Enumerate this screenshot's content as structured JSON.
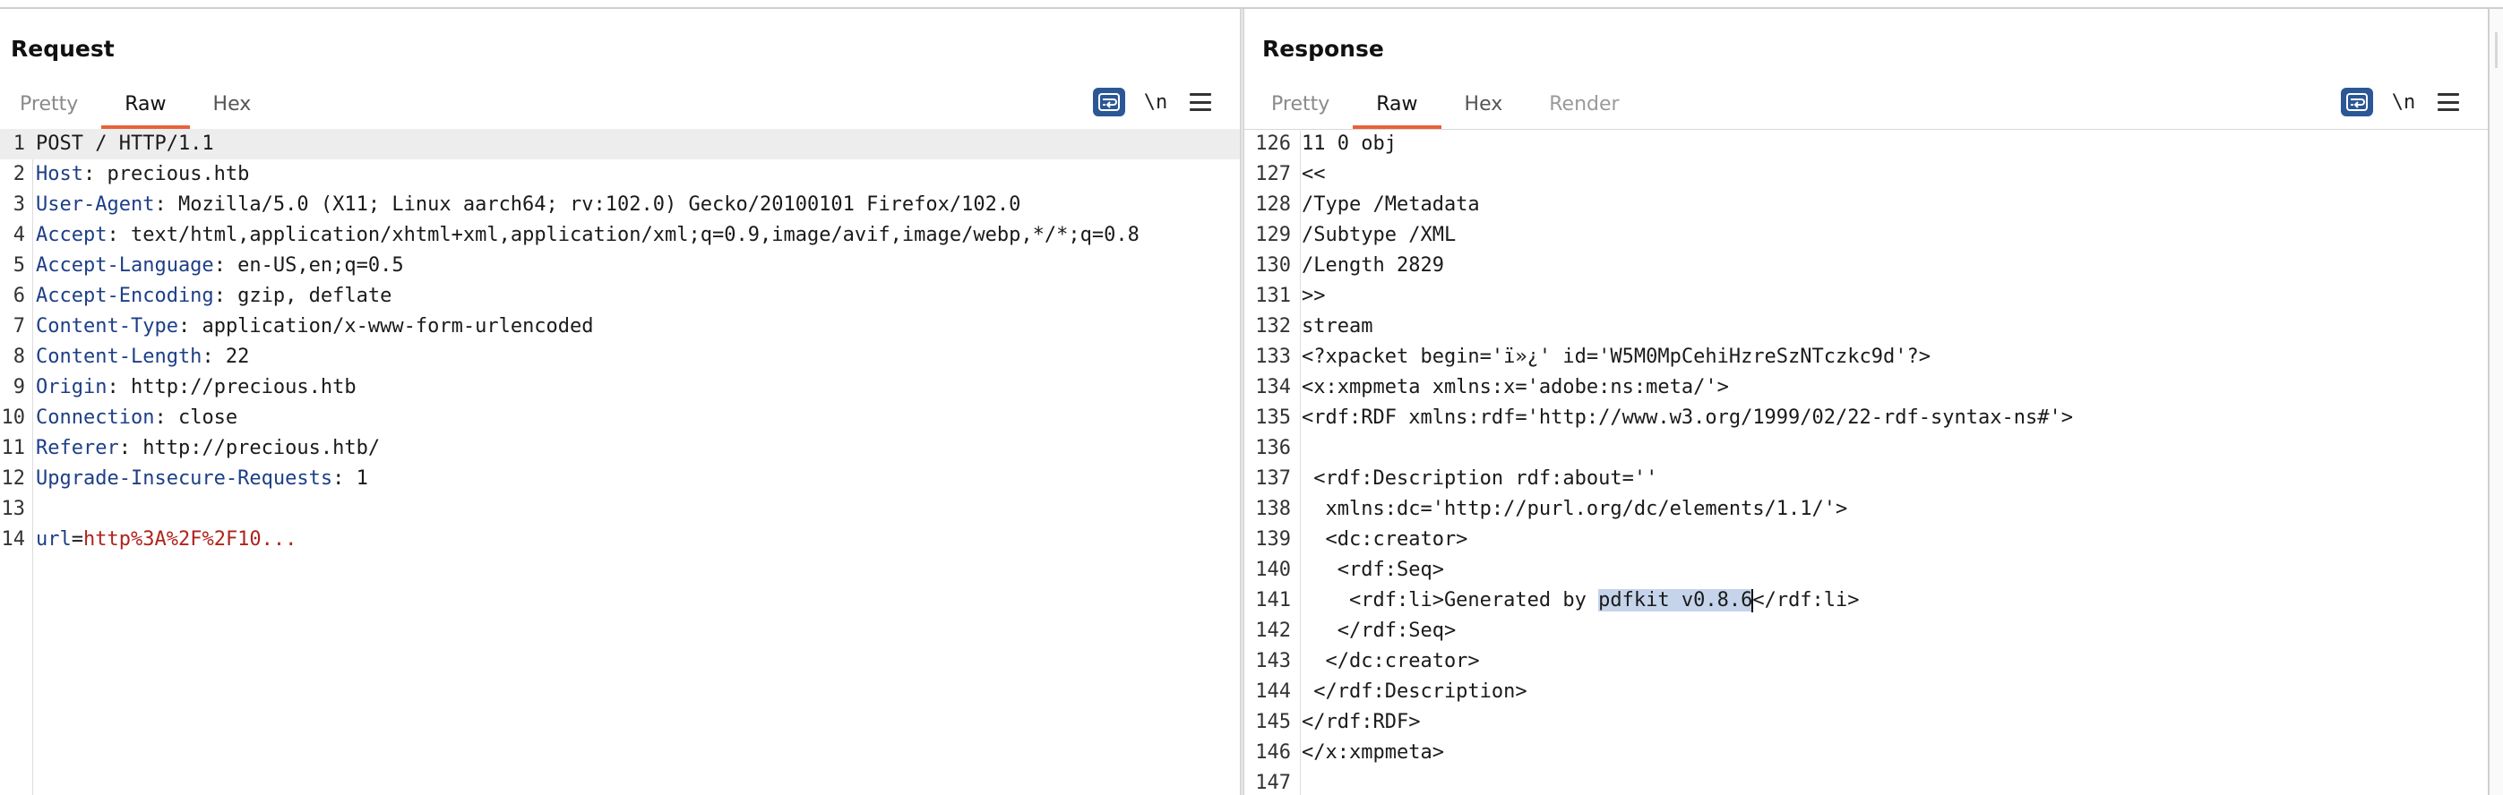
{
  "request": {
    "title": "Request",
    "tabs": [
      {
        "label": "Pretty",
        "state": "normal"
      },
      {
        "label": "Raw",
        "state": "active"
      },
      {
        "label": "Hex",
        "state": "normal"
      }
    ],
    "newline_label": "\\n",
    "lines": [
      {
        "n": "1",
        "text": "POST / HTTP/1.1"
      },
      {
        "n": "2",
        "name": "Host",
        "value": " precious.htb"
      },
      {
        "n": "3",
        "name": "User-Agent",
        "value": " Mozilla/5.0 (X11; Linux aarch64; rv:102.0) Gecko/20100101 Firefox/102.0"
      },
      {
        "n": "4",
        "name": "Accept",
        "value": " text/html,application/xhtml+xml,application/xml;q=0.9,image/avif,image/webp,*/*;q=0.8"
      },
      {
        "n": "5",
        "name": "Accept-Language",
        "value": " en-US,en;q=0.5"
      },
      {
        "n": "6",
        "name": "Accept-Encoding",
        "value": " gzip, deflate"
      },
      {
        "n": "7",
        "name": "Content-Type",
        "value": " application/x-www-form-urlencoded"
      },
      {
        "n": "8",
        "name": "Content-Length",
        "value": " 22"
      },
      {
        "n": "9",
        "name": "Origin",
        "value": " http://precious.htb"
      },
      {
        "n": "10",
        "name": "Connection",
        "value": " close"
      },
      {
        "n": "11",
        "name": "Referer",
        "value": " http://precious.htb/"
      },
      {
        "n": "12",
        "name": "Upgrade-Insecure-Requests",
        "value": " 1"
      },
      {
        "n": "13",
        "text": ""
      },
      {
        "n": "14",
        "param_name": "url",
        "param_value": "http%3A%2F%2F10..."
      }
    ]
  },
  "response": {
    "title": "Response",
    "tabs": [
      {
        "label": "Pretty",
        "state": "normal"
      },
      {
        "label": "Raw",
        "state": "active"
      },
      {
        "label": "Hex",
        "state": "normal"
      },
      {
        "label": "Render",
        "state": "disabled"
      }
    ],
    "newline_label": "\\n",
    "lines": [
      {
        "n": "126",
        "text": "11 0 obj"
      },
      {
        "n": "127",
        "text": "<<"
      },
      {
        "n": "128",
        "text": "/Type /Metadata"
      },
      {
        "n": "129",
        "text": "/Subtype /XML"
      },
      {
        "n": "130",
        "text": "/Length 2829"
      },
      {
        "n": "131",
        "text": ">>"
      },
      {
        "n": "132",
        "text": "stream"
      },
      {
        "n": "133",
        "text": "<?xpacket begin='ï»¿' id='W5M0MpCehiHzreSzNTczkc9d'?>"
      },
      {
        "n": "134",
        "text": "<x:xmpmeta xmlns:x='adobe:ns:meta/'>"
      },
      {
        "n": "135",
        "text": "<rdf:RDF xmlns:rdf='http://www.w3.org/1999/02/22-rdf-syntax-ns#'>"
      },
      {
        "n": "136",
        "text": ""
      },
      {
        "n": "137",
        "text": " <rdf:Description rdf:about=''"
      },
      {
        "n": "138",
        "text": "  xmlns:dc='http://purl.org/dc/elements/1.1/'>"
      },
      {
        "n": "139",
        "text": "  <dc:creator>"
      },
      {
        "n": "140",
        "text": "   <rdf:Seq>"
      },
      {
        "n": "141",
        "before": "    <rdf:li>Generated by ",
        "selected": "pdfkit v0.8.6",
        "after": "</rdf:li>"
      },
      {
        "n": "142",
        "text": "   </rdf:Seq>"
      },
      {
        "n": "143",
        "text": "  </dc:creator>"
      },
      {
        "n": "144",
        "text": " </rdf:Description>"
      },
      {
        "n": "145",
        "text": "</rdf:RDF>"
      },
      {
        "n": "146",
        "text": "</x:xmpmeta>"
      },
      {
        "n": "147",
        "text": ""
      }
    ]
  },
  "colors": {
    "accent_tab": "#e8633a",
    "button_blue": "#2b5796",
    "header_name": "#1d3f87",
    "param_value": "#b0231c",
    "selection": "#c5d4ea"
  },
  "icons": {
    "wrap": "word-wrap-icon",
    "menu": "hamburger-menu-icon",
    "layouts": [
      "side-by-side-layout-icon",
      "top-bottom-layout-icon",
      "single-pane-layout-icon"
    ]
  }
}
